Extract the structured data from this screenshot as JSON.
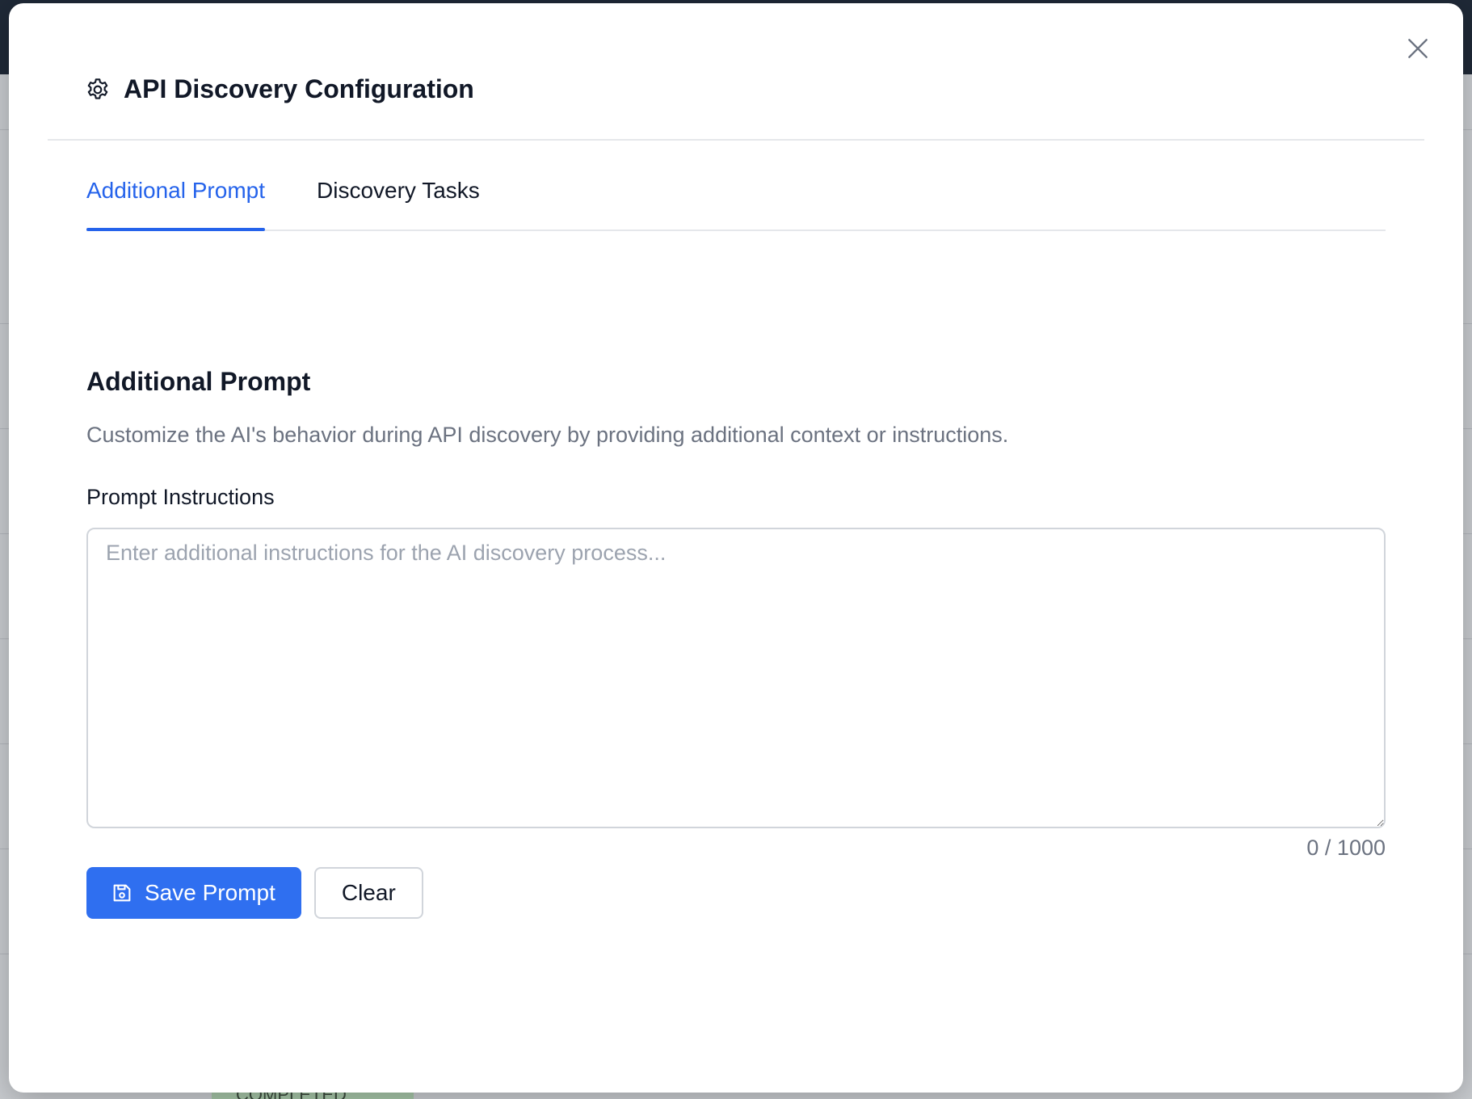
{
  "background": {
    "status_fragment": "COMPLETED"
  },
  "modal": {
    "title": "API Discovery Configuration",
    "close_icon": "close-icon",
    "settings_icon": "gear-icon"
  },
  "tabs": [
    {
      "label": "Additional Prompt",
      "active": true
    },
    {
      "label": "Discovery Tasks",
      "active": false
    }
  ],
  "section": {
    "title": "Additional Prompt",
    "description": "Customize the AI's behavior during API discovery by providing additional context or instructions.",
    "field_label": "Prompt Instructions",
    "textarea_value": "",
    "textarea_placeholder": "Enter additional instructions for the AI discovery process...",
    "counter": "0 / 1000"
  },
  "actions": {
    "save_label": "Save Prompt",
    "save_icon": "save-icon",
    "clear_label": "Clear"
  },
  "colors": {
    "accent": "#2563eb",
    "primary_button": "#2f6ff0"
  }
}
